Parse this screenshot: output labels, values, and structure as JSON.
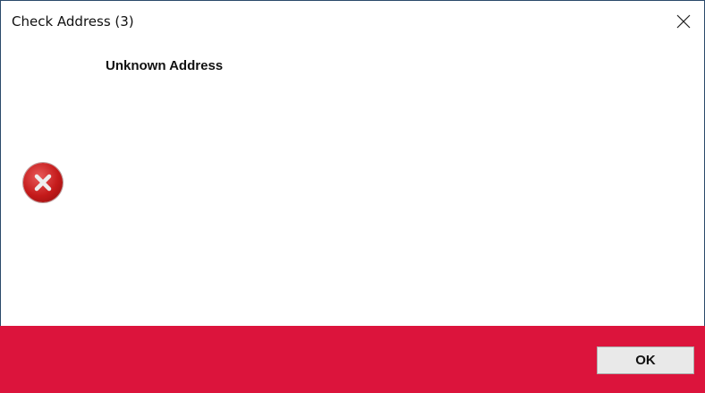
{
  "window": {
    "title": "Check Address (3)"
  },
  "message": {
    "text": "Unknown Address",
    "icon": "error-icon"
  },
  "footer": {
    "ok_label": "OK",
    "band_color": "#dc143c"
  }
}
